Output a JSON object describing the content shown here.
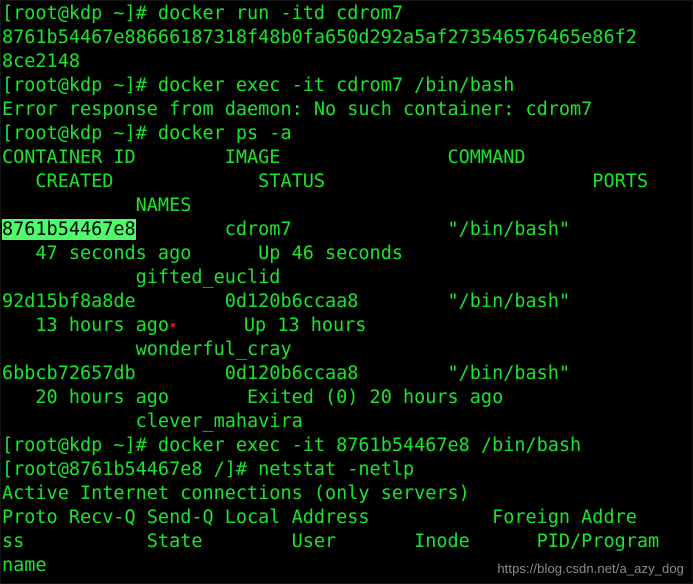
{
  "terminal": {
    "title": "root@kdp terminal",
    "foreground_color": "#1ae52b",
    "background_color": "#000000",
    "selection_background": "#4dfb6d",
    "selection_foreground": "#000000",
    "cursor_artifact_color": "#cc1111",
    "columns": 57,
    "rows": 24
  },
  "lines": {
    "l01": "[root@kdp ~]# docker run -itd cdrom7",
    "l02": "8761b54467e88666187318f48b0fa650d292a5af273546576465e86f2",
    "l03": "8ce2148",
    "l04": "[root@kdp ~]# docker exec -it cdrom7 /bin/bash",
    "l05": "Error response from daemon: No such container: cdrom7",
    "l06": "[root@kdp ~]# docker ps -a",
    "l07": "CONTAINER ID        IMAGE               COMMAND",
    "l08": "   CREATED             STATUS                        PORTS",
    "l09": "            NAMES",
    "l10_sel": "8761b54467e8",
    "l10_rest": "        cdrom7              \"/bin/bash\"",
    "l11": "   47 seconds ago      Up 46 seconds",
    "l12": "            gifted_euclid",
    "l13": "92d15bf8a8de        0d120b6ccaa8        \"/bin/bash\"",
    "l14_a": "   13 hours ago",
    "l14_b": "      Up 13 hours",
    "l15": "            wonderful_cray",
    "l16": "6bbcb72657db        0d120b6ccaa8        \"/bin/bash\"",
    "l17": "   20 hours ago       Exited (0) 20 hours ago",
    "l18": "            clever_mahavira",
    "l19": "[root@kdp ~]# docker exec -it 8761b54467e8 /bin/bash",
    "l20": "[root@8761b54467e8 /]# netstat -netlp",
    "l21": "Active Internet connections (only servers)",
    "l22": "Proto Recv-Q Send-Q Local Address           Foreign Addre",
    "l23": "ss           State        User       Inode      PID/Program",
    "l24": "name"
  },
  "watermark": {
    "text": "https://blog.csdn.net/a_azy_dog"
  }
}
